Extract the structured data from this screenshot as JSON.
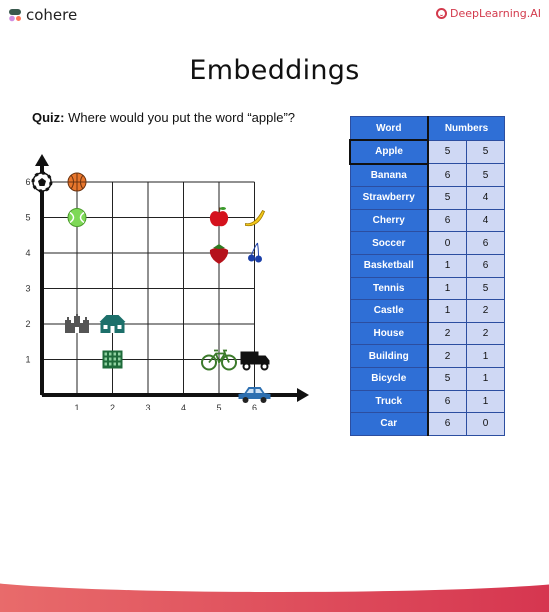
{
  "brand": {
    "left": "cohere",
    "right": "DeepLearning.AI",
    "right_color": "#d33a4c"
  },
  "title": "Embeddings",
  "quiz": {
    "label": "Quiz:",
    "text": "Where would you put the word “apple”?"
  },
  "table": {
    "headers": [
      "Word",
      "Numbers"
    ],
    "rows": [
      {
        "word": "Apple",
        "a": "5",
        "b": "5",
        "selected": true
      },
      {
        "word": "Banana",
        "a": "6",
        "b": "5"
      },
      {
        "word": "Strawberry",
        "a": "5",
        "b": "4"
      },
      {
        "word": "Cherry",
        "a": "6",
        "b": "4"
      },
      {
        "word": "Soccer",
        "a": "0",
        "b": "6"
      },
      {
        "word": "Basketball",
        "a": "1",
        "b": "6"
      },
      {
        "word": "Tennis",
        "a": "1",
        "b": "5"
      },
      {
        "word": "Castle",
        "a": "1",
        "b": "2"
      },
      {
        "word": "House",
        "a": "2",
        "b": "2"
      },
      {
        "word": "Building",
        "a": "2",
        "b": "1"
      },
      {
        "word": "Bicycle",
        "a": "5",
        "b": "1"
      },
      {
        "word": "Truck",
        "a": "6",
        "b": "1"
      },
      {
        "word": "Car",
        "a": "6",
        "b": "0"
      }
    ]
  },
  "chart_data": {
    "type": "scatter",
    "title": "",
    "xlabel": "",
    "ylabel": "",
    "xlim": [
      0,
      6
    ],
    "ylim": [
      0,
      6
    ],
    "grid": true,
    "x_ticks": [
      "1",
      "2",
      "3",
      "4",
      "5",
      "6"
    ],
    "y_ticks": [
      "1",
      "2",
      "3",
      "4",
      "5",
      "6"
    ],
    "points": [
      {
        "x": 0,
        "y": 6,
        "icon": "soccer-ball-icon"
      },
      {
        "x": 1,
        "y": 6,
        "icon": "basketball-icon"
      },
      {
        "x": 1,
        "y": 5,
        "icon": "tennis-ball-icon"
      },
      {
        "x": 5,
        "y": 5,
        "icon": "apple-icon"
      },
      {
        "x": 6,
        "y": 5,
        "icon": "banana-icon"
      },
      {
        "x": 5,
        "y": 4,
        "icon": "strawberry-icon"
      },
      {
        "x": 6,
        "y": 4,
        "icon": "cherry-icon"
      },
      {
        "x": 1,
        "y": 2,
        "icon": "castle-icon"
      },
      {
        "x": 2,
        "y": 2,
        "icon": "house-icon"
      },
      {
        "x": 2,
        "y": 1,
        "icon": "building-icon"
      },
      {
        "x": 5,
        "y": 1,
        "icon": "bicycle-icon"
      },
      {
        "x": 6,
        "y": 1,
        "icon": "truck-icon"
      },
      {
        "x": 6,
        "y": 0,
        "icon": "car-icon"
      }
    ]
  }
}
